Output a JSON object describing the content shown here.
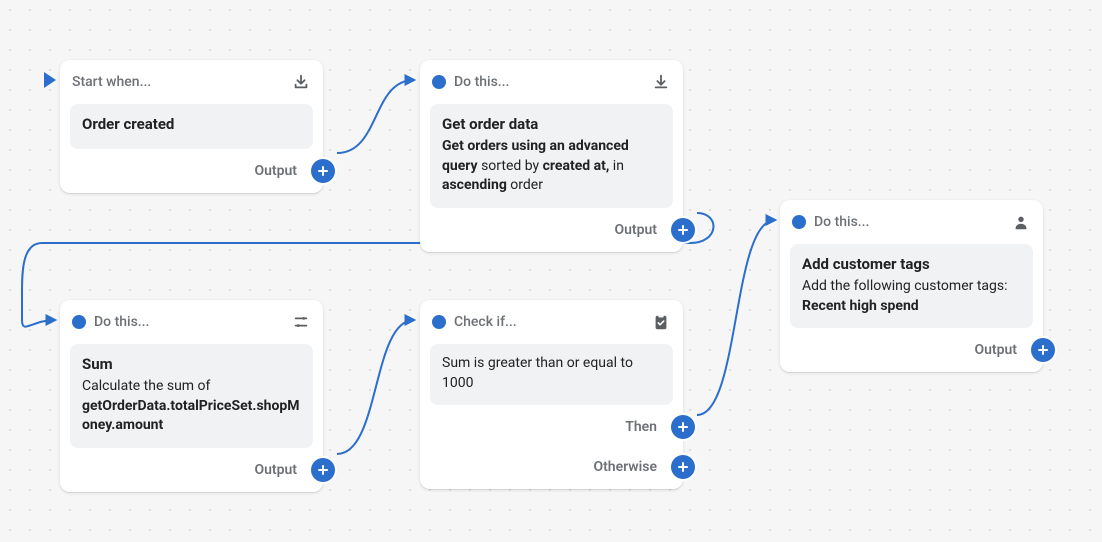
{
  "nodes": {
    "start": {
      "header": "Start when...",
      "title": "Order created",
      "outputs": [
        {
          "label": "Output"
        }
      ]
    },
    "getOrderData": {
      "header": "Do this...",
      "title": "Get order data",
      "desc_prefix": "Get orders using an advanced query",
      "desc_mid1": " sorted by ",
      "desc_bold2": "created at,",
      "desc_mid2": " in ",
      "desc_bold3": "ascending",
      "desc_suffix": " order",
      "outputs": [
        {
          "label": "Output"
        }
      ]
    },
    "sum": {
      "header": "Do this...",
      "title": "Sum",
      "desc_prefix": "Calculate the sum of ",
      "desc_bold": "getOrderData.totalPriceSet.shopMoney.amount",
      "outputs": [
        {
          "label": "Output"
        }
      ]
    },
    "check": {
      "header": "Check if...",
      "condition": "Sum is greater than or equal to 1000",
      "outputs": [
        {
          "label": "Then"
        },
        {
          "label": "Otherwise"
        }
      ]
    },
    "addTags": {
      "header": "Do this...",
      "title": "Add customer tags",
      "desc_prefix": "Add the following customer tags: ",
      "desc_bold": "Recent high spend",
      "outputs": [
        {
          "label": "Output"
        }
      ]
    }
  }
}
